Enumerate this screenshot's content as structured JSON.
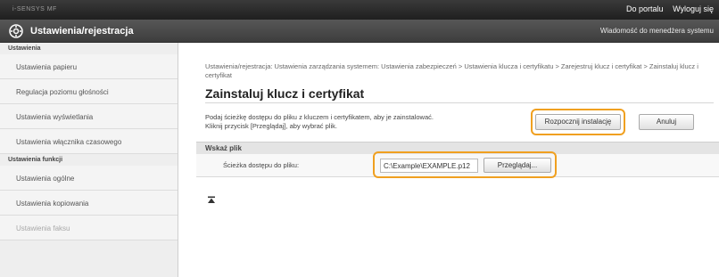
{
  "topbar": {
    "product_name": "i-SENSYS MF ",
    "portal_link": "Do portalu",
    "logout_link": "Wyloguj się"
  },
  "header": {
    "title": "Ustawienia/rejestracja",
    "message_to_admin": "Wiadomość do menedżera systemu"
  },
  "sidebar": {
    "section_settings": "Ustawienia",
    "items_settings": [
      {
        "label": "Ustawienia papieru"
      },
      {
        "label": "Regulacja poziomu głośności"
      },
      {
        "label": "Ustawienia wyświetlania"
      },
      {
        "label": "Ustawienia włącznika czasowego"
      }
    ],
    "section_functions": "Ustawienia funkcji",
    "items_functions": [
      {
        "label": "Ustawienia ogólne"
      },
      {
        "label": "Ustawienia kopiowania"
      },
      {
        "label": "Ustawienia faksu"
      }
    ]
  },
  "main": {
    "breadcrumb": "Ustawienia/rejestracja: Ustawienia zarządzania systemem: Ustawienia zabezpieczeń > Ustawienia klucza i certyfikatu > Zarejestruj klucz i certyfikat > Zainstaluj klucz i certyfikat",
    "page_title": "Zainstaluj klucz i certyfikat",
    "description_line1": "Podaj ścieżkę dostępu do pliku z kluczem i certyfikatem, aby je zainstalować.",
    "description_line2": "Kliknij przycisk [Przeglądaj], aby wybrać plik.",
    "start_install_button": "Rozpocznij instalację",
    "cancel_button": "Anuluj",
    "section_title": "Wskaż plik",
    "file_path_label": "Ścieżka dostępu do pliku:",
    "file_path_value": "C:\\Example\\EXAMPLE.p12",
    "browse_button": "Przeglądaj..."
  },
  "colors": {
    "highlight": "#f0a020",
    "topbar": "#2a2a2a",
    "titlebar": "#4a4a4a"
  },
  "icons": {
    "header_icon": "gear-icon",
    "page_top_icon": "page-top-icon"
  }
}
